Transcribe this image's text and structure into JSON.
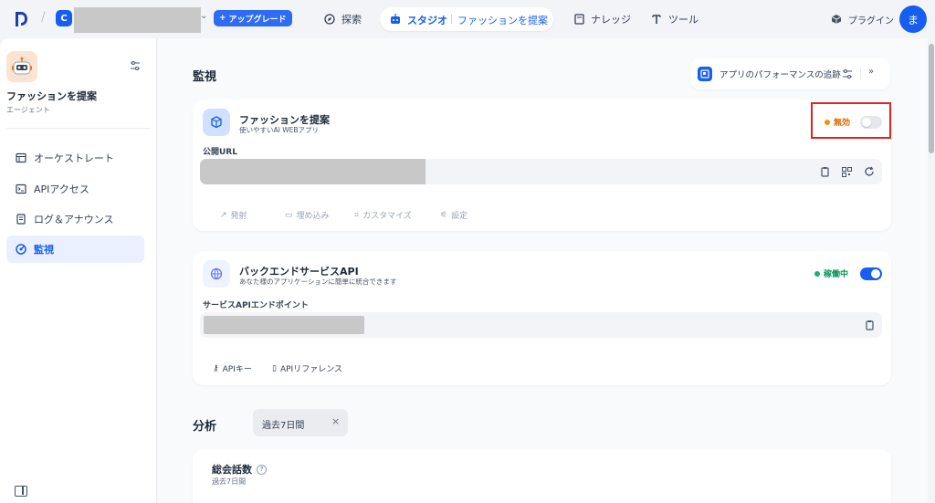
{
  "topbar": {
    "workspace_initial": "C",
    "upgrade_label": "アップグレード",
    "nav": {
      "explore": "探索",
      "studio": "スタジオ",
      "current_app": "ファッションを提案",
      "knowledge": "ナレッジ",
      "tools": "ツール",
      "plugins": "プラグイン"
    },
    "avatar_initial": "ま"
  },
  "sidebar": {
    "app_name": "ファッションを提案",
    "app_type": "エージェント",
    "items": [
      {
        "label": "オーケストレート",
        "icon": "orchestrate-icon",
        "active": false
      },
      {
        "label": "APIアクセス",
        "icon": "terminal-icon",
        "active": false
      },
      {
        "label": "ログ＆アナウンス",
        "icon": "log-icon",
        "active": false
      },
      {
        "label": "監視",
        "icon": "monitor-icon",
        "active": true
      }
    ]
  },
  "main": {
    "monitor_title": "監視",
    "tracking_label": "アプリのパフォーマンスの追跡",
    "webapp_card": {
      "title": "ファッションを提案",
      "subtitle": "使いやすいAI WEBアプリ",
      "status": "無効",
      "status_color": "#f79009",
      "enabled": false,
      "url_label": "公開URL",
      "actions": [
        "発射",
        "埋め込み",
        "カスタマイズ",
        "設定"
      ]
    },
    "api_card": {
      "title": "バックエンドサービスAPI",
      "subtitle": "あなた様のアプリケーションに簡単に統合できます",
      "status": "稼働中",
      "status_color": "#17b26a",
      "enabled": true,
      "endpoint_label": "サービスAPIエンドポイント",
      "actions": [
        "APIキー",
        "APIリファレンス"
      ]
    },
    "analysis_title": "分析",
    "period_filter": "過去7日間",
    "total_card": {
      "title": "総会話数",
      "subtitle": "過去7日間"
    }
  },
  "colors": {
    "accent": "#155eef",
    "highlight": "#e02424"
  }
}
